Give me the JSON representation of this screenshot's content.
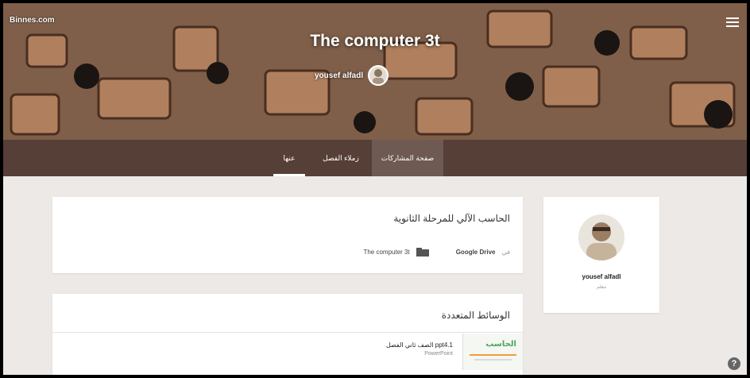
{
  "site": {
    "name": "Binnes.com"
  },
  "hero": {
    "title": "The computer 3t",
    "owner_name": "yousef alfadl"
  },
  "nav": {
    "tabs": [
      {
        "label": "عنها"
      },
      {
        "label": "زملاء الفصل"
      },
      {
        "label": "صفحة المشاركات"
      }
    ]
  },
  "main": {
    "description_card": {
      "title": "الحاسب الآلي للمرحلة الثانوية",
      "storage_label": "Google Drive",
      "storage_suffix": "في",
      "folder_label": "The computer 3t"
    },
    "media_card": {
      "title": "الوسائط المتعددة",
      "file_name": "ppt4.1 الصف ثاني الفصل",
      "file_type": "PowerPoint",
      "thumb_text": "الحاسب"
    }
  },
  "profile": {
    "name": "yousef alfadl",
    "role": "معلم"
  },
  "help": {
    "label": "?"
  },
  "colors": {
    "nav_bg": "#553f36",
    "nav_active": "#6e5a52",
    "page_bg": "#ece9e6"
  },
  "icons": [
    "menu-icon",
    "folder-icon",
    "help-icon"
  ]
}
